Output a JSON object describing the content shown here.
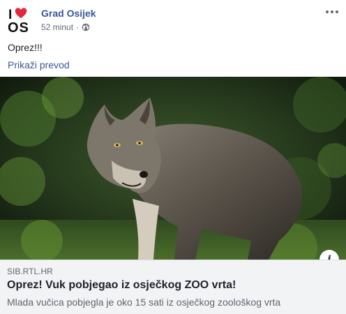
{
  "post": {
    "page_name": "Grad Osijek",
    "timestamp": "52 minut",
    "meta_separator": "·",
    "privacy_icon": "globe-icon",
    "text": "Oprez!!!",
    "translate_label": "Prikaži prevod",
    "more_icon": "more-options-icon"
  },
  "avatar": {
    "line1_left": "I",
    "line2": "OS",
    "heart_color": "#e4253b"
  },
  "link_preview": {
    "domain": "SIB.RTL.HR",
    "title": "Oprez! Vuk pobjegao iz osječkog ZOO vrta!",
    "description": "Mlada vučica pobjegla je oko 15 sati iz osječkog zoološkog vrta",
    "info_icon": "i"
  },
  "colors": {
    "link_blue": "#385898",
    "secondary_text": "#606770",
    "preview_bg": "#f2f3f5"
  }
}
